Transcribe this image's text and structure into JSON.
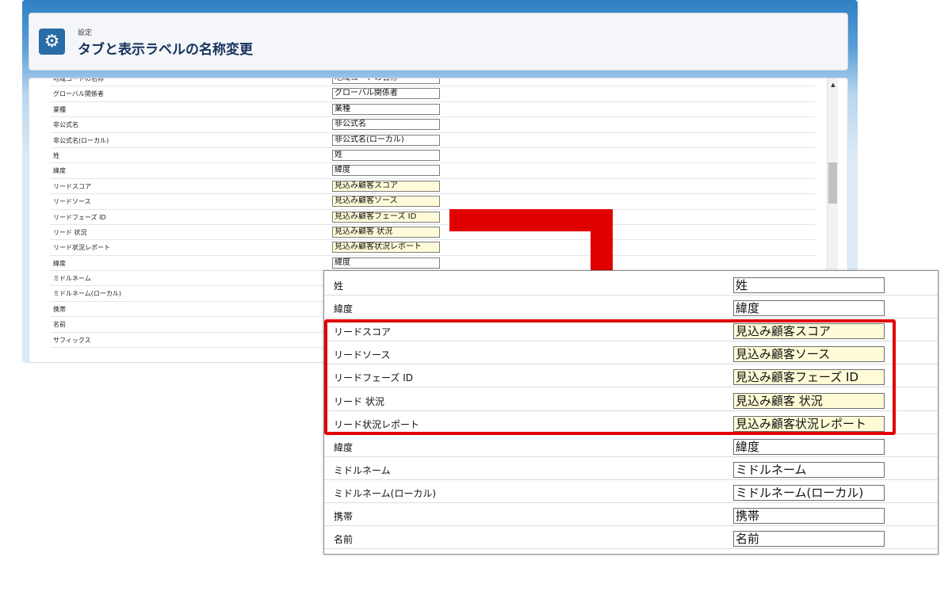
{
  "header": {
    "eyebrow": "設定",
    "title": "タブと表示ラベルの名称変更",
    "icon": "gear-icon"
  },
  "background_rows": [
    {
      "label": "地域コードの名称",
      "value": "地域コードの名称",
      "highlighted": false
    },
    {
      "label": "グローバル関係者",
      "value": "グローバル関係者",
      "highlighted": false
    },
    {
      "label": "業種",
      "value": "業種",
      "highlighted": false
    },
    {
      "label": "非公式名",
      "value": "非公式名",
      "highlighted": false
    },
    {
      "label": "非公式名(ローカル)",
      "value": "非公式名(ローカル)",
      "highlighted": false
    },
    {
      "label": "姓",
      "value": "姓",
      "highlighted": false
    },
    {
      "label": "緯度",
      "value": "緯度",
      "highlighted": false
    },
    {
      "label": "リードスコア",
      "value": "見込み顧客スコア",
      "highlighted": true
    },
    {
      "label": "リードソース",
      "value": "見込み顧客ソース",
      "highlighted": true
    },
    {
      "label": "リードフェーズ ID",
      "value": "見込み顧客フェーズ ID",
      "highlighted": true
    },
    {
      "label": "リード 状況",
      "value": "見込み顧客 状況",
      "highlighted": true
    },
    {
      "label": "リード状況レポート",
      "value": "見込み顧客状況レポート",
      "highlighted": true
    },
    {
      "label": "緯度",
      "value": "緯度",
      "highlighted": false
    },
    {
      "label": "ミドルネーム",
      "value": "",
      "highlighted": false
    },
    {
      "label": "ミドルネーム(ローカル)",
      "value": "",
      "highlighted": false
    },
    {
      "label": "携帯",
      "value": "",
      "highlighted": false
    },
    {
      "label": "名前",
      "value": "",
      "highlighted": false
    },
    {
      "label": "サフィックス",
      "value": "",
      "highlighted": false
    }
  ],
  "zoom_rows": [
    {
      "label": "姓",
      "value": "姓",
      "highlighted": false
    },
    {
      "label": "緯度",
      "value": "緯度",
      "highlighted": false
    },
    {
      "label": "リードスコア",
      "value": "見込み顧客スコア",
      "highlighted": true
    },
    {
      "label": "リードソース",
      "value": "見込み顧客ソース",
      "highlighted": true
    },
    {
      "label": "リードフェーズ ID",
      "value": "見込み顧客フェーズ ID",
      "highlighted": true
    },
    {
      "label": "リード 状況",
      "value": "見込み顧客 状況",
      "highlighted": true
    },
    {
      "label": "リード状況レポート",
      "value": "見込み顧客状況レポート",
      "highlighted": true
    },
    {
      "label": "緯度",
      "value": "緯度",
      "highlighted": false
    },
    {
      "label": "ミドルネーム",
      "value": "ミドルネーム",
      "highlighted": false
    },
    {
      "label": "ミドルネーム(ローカル)",
      "value": "ミドルネーム(ローカル)",
      "highlighted": false
    },
    {
      "label": "携帯",
      "value": "携帯",
      "highlighted": false
    },
    {
      "label": "名前",
      "value": "名前",
      "highlighted": false
    }
  ],
  "colors": {
    "accent": "#2a6ca6",
    "callout": "#e00000",
    "highlight_field": "#fffbd6"
  }
}
